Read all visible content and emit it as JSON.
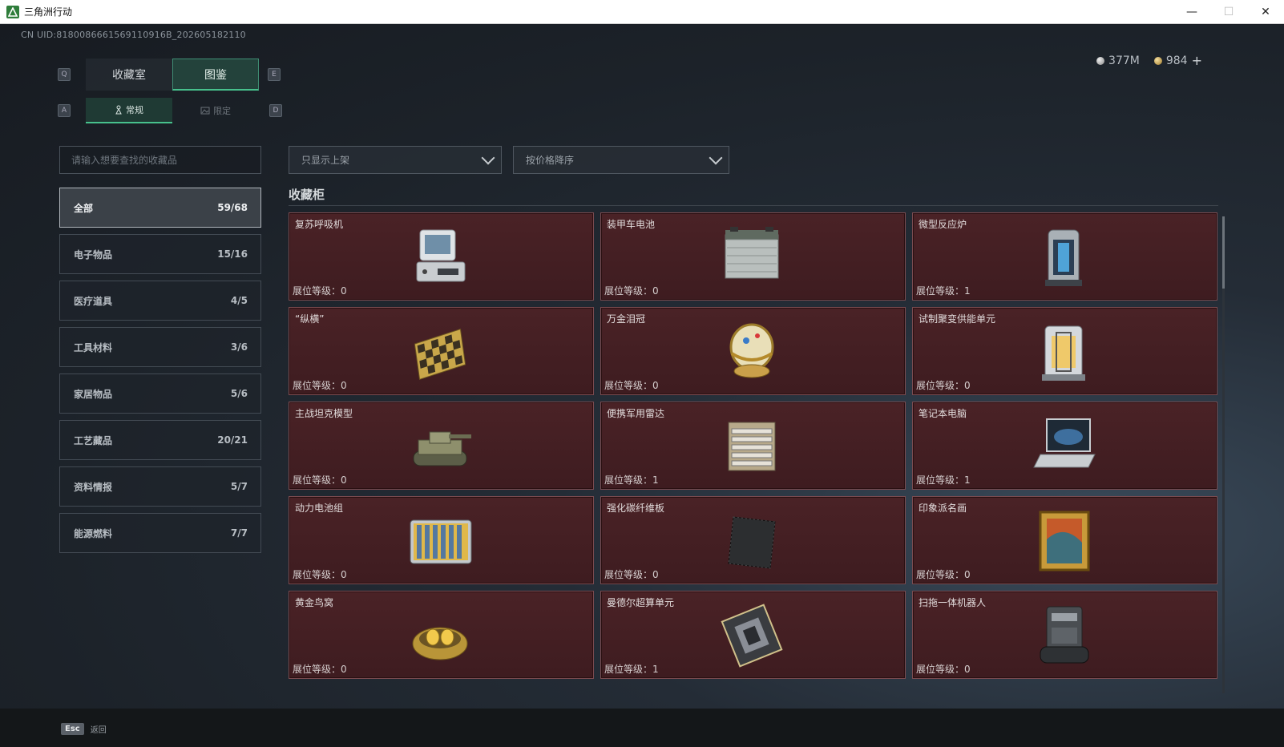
{
  "window": {
    "title": "三角洲行动",
    "minimize": "—",
    "maximize": "☐",
    "close": "✕"
  },
  "uid": "CN UID:8180086661569110916B_202605182110",
  "currency": {
    "silver": "377M",
    "gold": "984",
    "plus": "+"
  },
  "hotkeys": {
    "prev_tab": "Q",
    "next_tab": "E",
    "prev_sub": "A",
    "next_sub": "D"
  },
  "tabs": [
    {
      "label": "收藏室"
    },
    {
      "label": "图鉴"
    }
  ],
  "subtabs": [
    {
      "label": "常规"
    },
    {
      "label": "限定"
    }
  ],
  "search": {
    "placeholder": "请输入想要查找的收藏品"
  },
  "categories": [
    {
      "label": "全部",
      "count": "59/68",
      "active": true
    },
    {
      "label": "电子物品",
      "count": "15/16"
    },
    {
      "label": "医疗道具",
      "count": "4/5"
    },
    {
      "label": "工具材料",
      "count": "3/6"
    },
    {
      "label": "家居物品",
      "count": "5/6"
    },
    {
      "label": "工艺藏品",
      "count": "20/21"
    },
    {
      "label": "资料情报",
      "count": "5/7"
    },
    {
      "label": "能源燃料",
      "count": "7/7"
    }
  ],
  "filters": {
    "shelf": "只显示上架",
    "sort": "按价格降序"
  },
  "section_title": "收藏柜",
  "items": [
    {
      "name": "复苏呼吸机",
      "level": "展位等级：0",
      "icon": "ventilator-icon"
    },
    {
      "name": "装甲车电池",
      "level": "展位等级：0",
      "icon": "battery-icon"
    },
    {
      "name": "微型反应炉",
      "level": "展位等级：1",
      "icon": "reactor-icon"
    },
    {
      "name": "“纵横”",
      "level": "展位等级：0",
      "icon": "chessboard-icon"
    },
    {
      "name": "万金泪冠",
      "level": "展位等级：0",
      "icon": "jeweled-egg-icon"
    },
    {
      "name": "试制聚变供能单元",
      "level": "展位等级：0",
      "icon": "fusion-unit-icon"
    },
    {
      "name": "主战坦克模型",
      "level": "展位等级：0",
      "icon": "tank-model-icon"
    },
    {
      "name": "便携军用雷达",
      "level": "展位等级：1",
      "icon": "radar-icon"
    },
    {
      "name": "笔记本电脑",
      "level": "展位等级：1",
      "icon": "laptop-icon"
    },
    {
      "name": "动力电池组",
      "level": "展位等级：0",
      "icon": "battery-pack-icon"
    },
    {
      "name": "强化碳纤维板",
      "level": "展位等级：0",
      "icon": "carbon-plate-icon"
    },
    {
      "name": "印象派名画",
      "level": "展位等级：0",
      "icon": "painting-icon"
    },
    {
      "name": "黄金鸟窝",
      "level": "展位等级：0",
      "icon": "golden-nest-icon"
    },
    {
      "name": "曼德尔超算单元",
      "level": "展位等级：1",
      "icon": "supercomputer-chip-icon"
    },
    {
      "name": "扫拖一体机器人",
      "level": "展位等级：0",
      "icon": "robot-vacuum-icon"
    }
  ],
  "footer": {
    "esc_key": "Esc",
    "back_label": "返回"
  }
}
